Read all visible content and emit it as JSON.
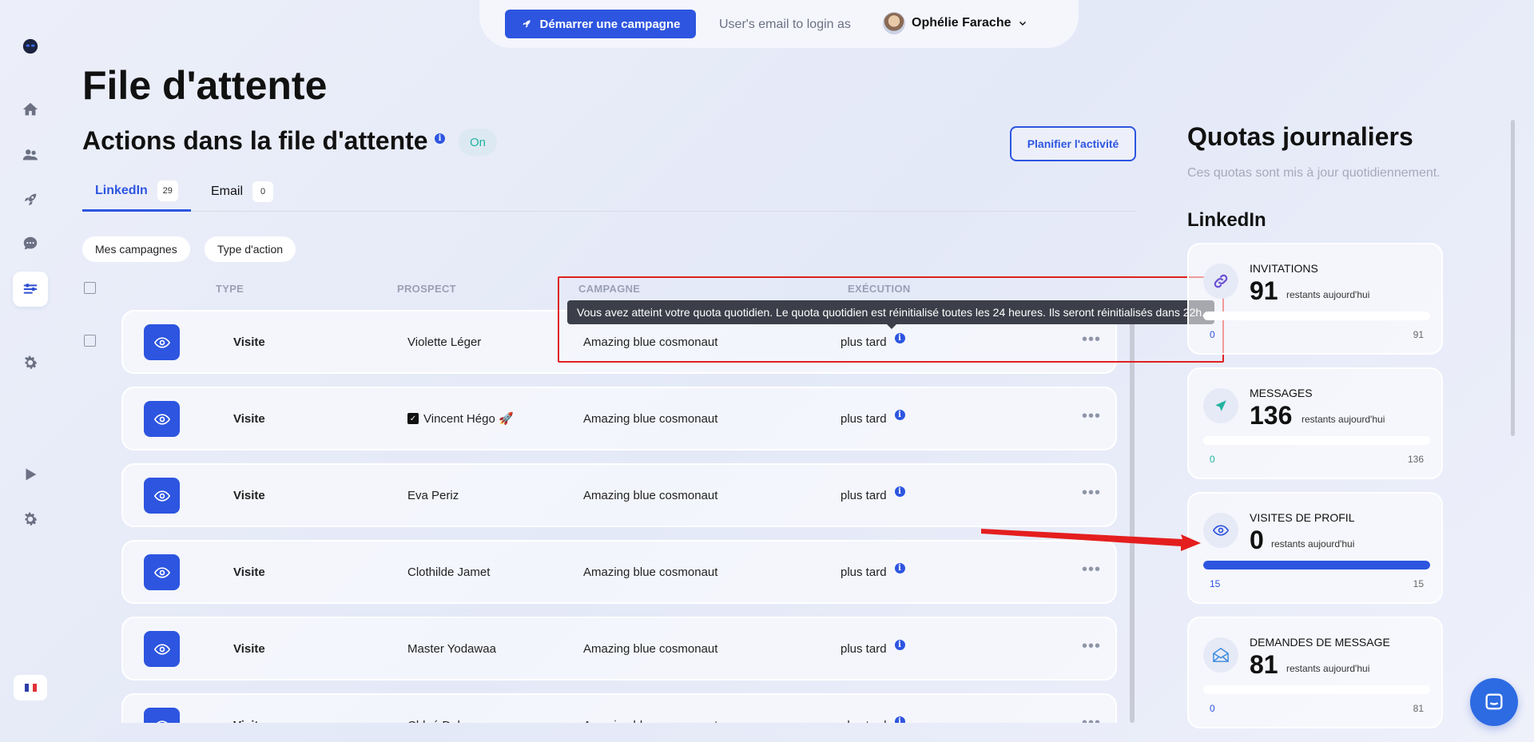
{
  "topbar": {
    "start_campaign": "Démarrer une campagne",
    "login_as": "User's email to login as",
    "user_name": "Ophélie Farache"
  },
  "page": {
    "title": "File d'attente",
    "section_title": "Actions dans la file d'attente",
    "toggle": "On",
    "plan_button": "Planifier l'activité"
  },
  "tabs": [
    {
      "label": "LinkedIn",
      "count": "29"
    },
    {
      "label": "Email",
      "count": "0"
    }
  ],
  "filters": [
    "Mes campagnes",
    "Type d'action"
  ],
  "columns": {
    "type": "TYPE",
    "prospect": "PROSPECT",
    "campaign": "CAMPAGNE",
    "exec": "EXÉCUTION"
  },
  "rows": [
    {
      "type": "Visite",
      "prospect": "Violette Léger",
      "campaign": "Amazing blue cosmonaut",
      "exec": "plus tard"
    },
    {
      "type": "Visite",
      "prospect": "Vincent Hégo 🚀",
      "campaign": "Amazing blue cosmonaut",
      "exec": "plus tard"
    },
    {
      "type": "Visite",
      "prospect": "Eva Periz",
      "campaign": "Amazing blue cosmonaut",
      "exec": "plus tard"
    },
    {
      "type": "Visite",
      "prospect": "Clothilde Jamet",
      "campaign": "Amazing blue cosmonaut",
      "exec": "plus tard"
    },
    {
      "type": "Visite",
      "prospect": "Master Yodawaa",
      "campaign": "Amazing blue cosmonaut",
      "exec": "plus tard"
    },
    {
      "type": "Visite",
      "prospect": "Chloé Delan",
      "campaign": "Amazing blue cosmonaut",
      "exec": "plus tard"
    }
  ],
  "tooltip": "Vous avez atteint votre quota quotidien. Le quota quotidien est réinitialisé toutes les 24 heures. Ils seront réinitialisés dans 22h.",
  "quotas": {
    "title": "Quotas journaliers",
    "subtitle": "Ces quotas sont mis à jour quotidiennement.",
    "section": "LinkedIn",
    "remaining_label": "restants aujourd'hui",
    "cards": [
      {
        "label": "INVITATIONS",
        "remaining": "91",
        "min": "0",
        "max": "91",
        "fill": 0,
        "icon": "link-icon",
        "min_color": "#2d55e0"
      },
      {
        "label": "MESSAGES",
        "remaining": "136",
        "min": "0",
        "max": "136",
        "fill": 0,
        "icon": "send-icon",
        "min_color": "#1fb3a0"
      },
      {
        "label": "VISITES DE PROFIL",
        "remaining": "0",
        "min": "15",
        "max": "15",
        "fill": 1,
        "icon": "eye-icon",
        "min_color": "#2d55e0"
      },
      {
        "label": "DEMANDES DE MESSAGE",
        "remaining": "81",
        "min": "0",
        "max": "81",
        "fill": 0,
        "icon": "mail-open-icon",
        "min_color": "#2d55e0"
      }
    ]
  },
  "colors": {
    "accent": "#2d55e0",
    "annotation": "#e02020"
  }
}
